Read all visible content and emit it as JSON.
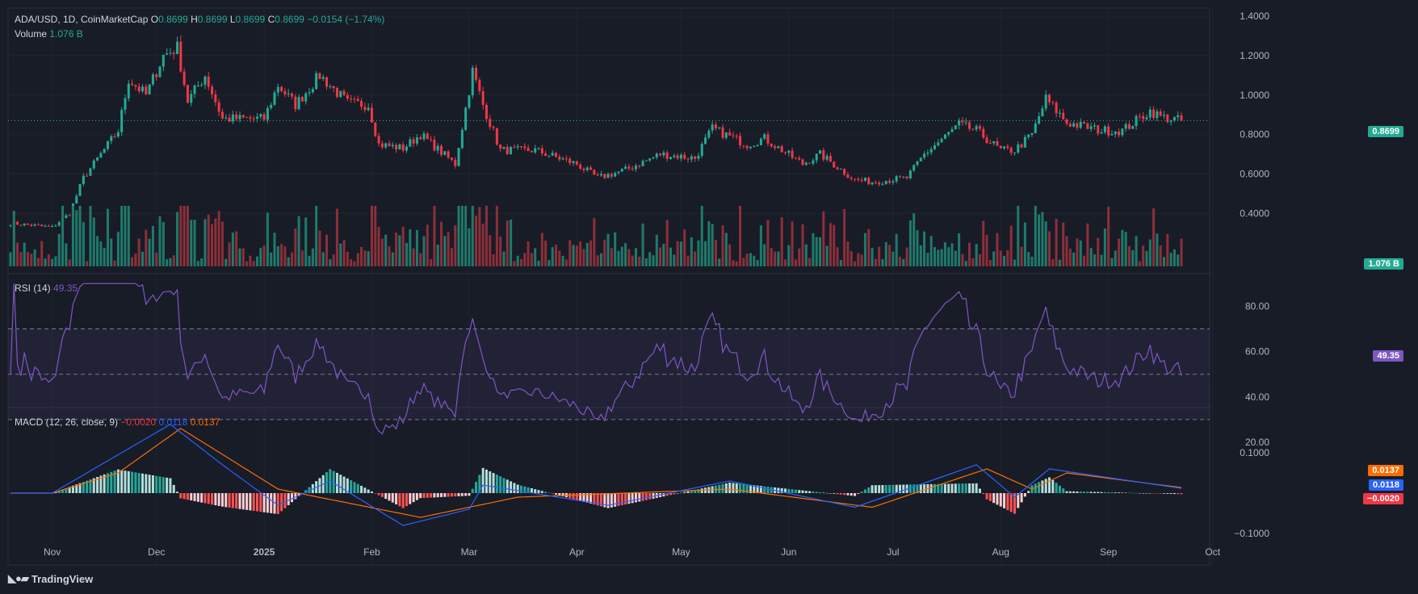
{
  "header": {
    "symbol": "ADA/USD, 1D, CoinMarketCap",
    "o_label": "O",
    "o": "0.8699",
    "h_label": "H",
    "h": "0.8699",
    "l_label": "L",
    "l": "0.8699",
    "c_label": "C",
    "c": "0.8699",
    "change": "−0.0154 (−1.74%)",
    "volume_label": "Volume",
    "volume": "1.076 B"
  },
  "rsi_legend": {
    "label": "RSI (14)",
    "value": "49.35"
  },
  "macd_legend": {
    "label": "MACD (12, 26, close, 9)",
    "hist": "−0.0020",
    "macd": "0.0118",
    "signal": "0.0137"
  },
  "tags": {
    "price": "0.8699",
    "volume": "1.076 B",
    "rsi": "49.35",
    "signal": "0.0137",
    "macd": "0.0118",
    "hist": "−0.0020"
  },
  "brand": "TradingView",
  "colors": {
    "up": "#22ab94",
    "down": "#f23645",
    "rsi": "#7e57c2",
    "macd": "#2962ff",
    "signal": "#ff6d00",
    "background": "#181c27"
  },
  "chart_data": {
    "type": "candlestick",
    "price_axis": {
      "ticks": [
        "1.4000",
        "1.2000",
        "1.0000",
        "0.8000",
        "0.6000",
        "0.4000"
      ],
      "ylim": [
        0.25,
        1.4
      ]
    },
    "rsi_axis": {
      "ticks": [
        "80.00",
        "60.00",
        "40.00",
        "20.00"
      ],
      "bands": [
        70,
        50,
        30
      ]
    },
    "macd_axis": {
      "ticks": [
        "0.1000",
        "−0.1000"
      ]
    },
    "time_axis": [
      "Nov",
      "Dec",
      "2025",
      "Feb",
      "Mar",
      "Apr",
      "May",
      "Jun",
      "Jul",
      "Aug",
      "Sep",
      "Oct"
    ],
    "close_keypoints": [
      [
        "2024-10-20",
        0.35
      ],
      [
        "2024-11-01",
        0.33
      ],
      [
        "2024-11-06",
        0.4
      ],
      [
        "2024-11-10",
        0.58
      ],
      [
        "2024-11-15",
        0.7
      ],
      [
        "2024-11-20",
        0.82
      ],
      [
        "2024-11-23",
        1.08
      ],
      [
        "2024-11-28",
        1.0
      ],
      [
        "2024-12-03",
        1.2
      ],
      [
        "2024-12-07",
        1.24
      ],
      [
        "2024-12-10",
        0.97
      ],
      [
        "2024-12-15",
        1.1
      ],
      [
        "2024-12-20",
        0.88
      ],
      [
        "2025-01-01",
        0.88
      ],
      [
        "2025-01-05",
        1.05
      ],
      [
        "2025-01-10",
        0.95
      ],
      [
        "2025-01-17",
        1.1
      ],
      [
        "2025-01-25",
        0.96
      ],
      [
        "2025-01-31",
        0.95
      ],
      [
        "2025-02-03",
        0.75
      ],
      [
        "2025-02-10",
        0.73
      ],
      [
        "2025-02-15",
        0.8
      ],
      [
        "2025-02-25",
        0.65
      ],
      [
        "2025-03-02",
        1.12
      ],
      [
        "2025-03-05",
        0.95
      ],
      [
        "2025-03-10",
        0.72
      ],
      [
        "2025-03-20",
        0.72
      ],
      [
        "2025-04-01",
        0.65
      ],
      [
        "2025-04-07",
        0.58
      ],
      [
        "2025-04-15",
        0.62
      ],
      [
        "2025-04-25",
        0.7
      ],
      [
        "2025-05-05",
        0.68
      ],
      [
        "2025-05-10",
        0.83
      ],
      [
        "2025-05-20",
        0.75
      ],
      [
        "2025-05-25",
        0.78
      ],
      [
        "2025-06-05",
        0.65
      ],
      [
        "2025-06-10",
        0.7
      ],
      [
        "2025-06-20",
        0.57
      ],
      [
        "2025-06-25",
        0.56
      ],
      [
        "2025-07-05",
        0.58
      ],
      [
        "2025-07-10",
        0.7
      ],
      [
        "2025-07-20",
        0.85
      ],
      [
        "2025-07-25",
        0.82
      ],
      [
        "2025-08-01",
        0.72
      ],
      [
        "2025-08-05",
        0.72
      ],
      [
        "2025-08-10",
        0.8
      ],
      [
        "2025-08-14",
        0.98
      ],
      [
        "2025-08-20",
        0.86
      ],
      [
        "2025-08-30",
        0.82
      ],
      [
        "2025-09-05",
        0.82
      ],
      [
        "2025-09-13",
        0.92
      ],
      [
        "2025-09-16",
        0.89
      ],
      [
        "2025-09-22",
        0.87
      ]
    ],
    "macd_series_keypoints": {
      "macd": [
        [
          "2024-11-01",
          0.0
        ],
        [
          "2024-11-15",
          0.07
        ],
        [
          "2024-12-05",
          0.17
        ],
        [
          "2024-12-20",
          0.07
        ],
        [
          "2025-01-05",
          -0.03
        ],
        [
          "2025-01-20",
          0.03
        ],
        [
          "2025-02-10",
          -0.08
        ],
        [
          "2025-03-01",
          -0.04
        ],
        [
          "2025-03-05",
          0.02
        ],
        [
          "2025-04-10",
          -0.03
        ],
        [
          "2025-05-15",
          0.03
        ],
        [
          "2025-06-20",
          -0.035
        ],
        [
          "2025-07-25",
          0.07
        ],
        [
          "2025-08-05",
          -0.01
        ],
        [
          "2025-08-15",
          0.06
        ],
        [
          "2025-09-22",
          0.0118
        ]
      ],
      "signal": [
        [
          "2024-11-01",
          0.0
        ],
        [
          "2024-11-20",
          0.05
        ],
        [
          "2024-12-08",
          0.16
        ],
        [
          "2025-01-05",
          0.01
        ],
        [
          "2025-02-15",
          -0.06
        ],
        [
          "2025-03-15",
          -0.01
        ],
        [
          "2025-05-15",
          0.01
        ],
        [
          "2025-06-25",
          -0.035
        ],
        [
          "2025-07-28",
          0.06
        ],
        [
          "2025-08-10",
          0.01
        ],
        [
          "2025-08-20",
          0.05
        ],
        [
          "2025-09-22",
          0.0137
        ]
      ]
    },
    "last": {
      "close": 0.8699,
      "rsi": 49.35,
      "macd": 0.0118,
      "signal": 0.0137,
      "hist": -0.002
    }
  }
}
